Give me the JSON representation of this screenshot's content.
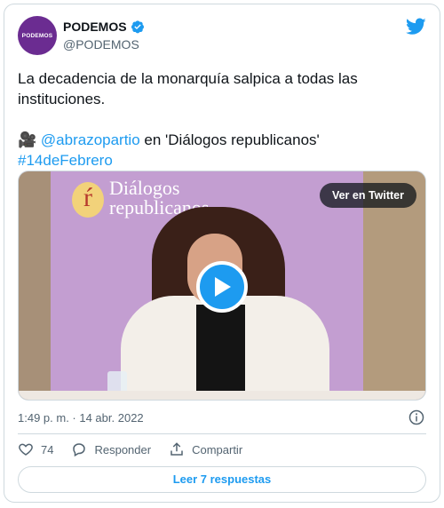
{
  "author": {
    "avatar_text": "PODEMOS",
    "display_name": "PODEMOS",
    "handle": "@PODEMOS"
  },
  "tweet": {
    "text_line1": "La decadencia de la monarquía salpica a todas las",
    "text_line2": "instituciones.",
    "camera_emoji": "🎥",
    "mention": "@abrazopartio",
    "mention_suffix": " en 'Diálogos republicanos'",
    "hashtag": "#14deFebrero"
  },
  "video": {
    "logo_letter": "ŕ",
    "logo_line1": "Diálogos",
    "logo_line2": "republicanos",
    "watch_label": "Ver en Twitter"
  },
  "meta": {
    "timestamp": "1:49 p. m. · 14 abr. 2022"
  },
  "actions": {
    "like_count": "74",
    "reply_label": "Responder",
    "share_label": "Compartir"
  },
  "replies_button_label": "Leer 7 respuestas",
  "colors": {
    "accent": "#1d9bf0",
    "secondary_text": "#536471",
    "border": "#cfd9de",
    "avatar_bg": "#6b2c91"
  }
}
